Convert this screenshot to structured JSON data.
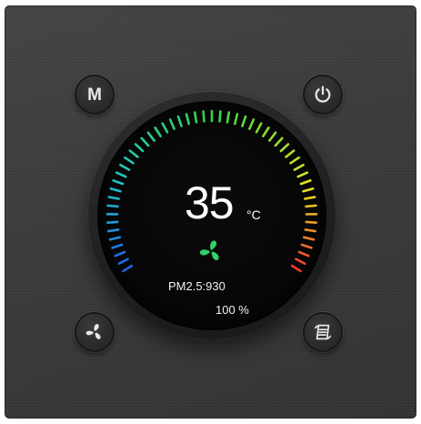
{
  "controls": {
    "mode_label": "M",
    "power_icon": "power-icon",
    "fan_icon": "fan-icon",
    "swing_icon": "swing-icon"
  },
  "display": {
    "temperature": "35",
    "unit": "°C",
    "fan_status_icon": "fan-icon",
    "pm25": "PM2.5:930",
    "percent": "100 %"
  },
  "colors": {
    "panel": "#3a3b3c",
    "screen": "#050505",
    "fan_status": "#2fd36a",
    "scale_cool": "#1e63e6",
    "scale_cyan": "#1fc6c8",
    "scale_green": "#33d34a",
    "scale_yellow": "#e6e41c",
    "scale_red": "#ef3b2e"
  }
}
